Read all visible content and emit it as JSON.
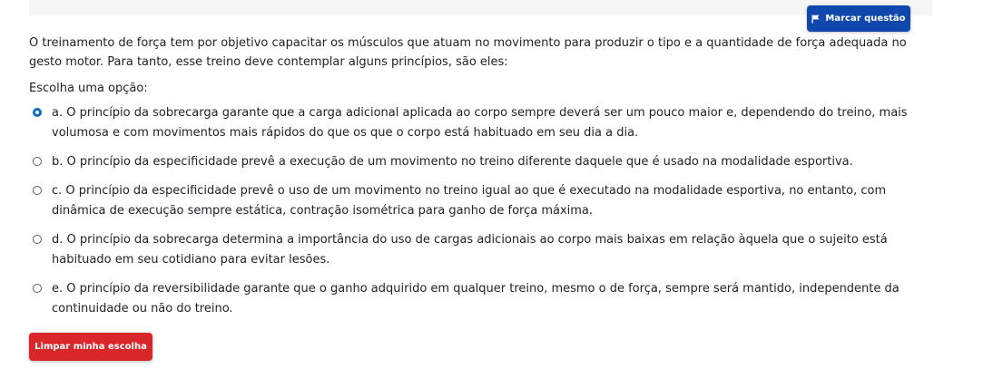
{
  "flag_button": {
    "label": "Marcar questão",
    "icon": "flag-icon"
  },
  "question": {
    "text": "O treinamento de força tem por objetivo capacitar os músculos que atuam no movimento para produzir o tipo e a quantidade de força adequada no gesto motor. Para tanto, esse treino deve contemplar alguns princípios, são eles:"
  },
  "prompt": "Escolha uma opção:",
  "options": [
    {
      "label": "a. O princípio da sobrecarga garante que a carga adicional aplicada ao corpo sempre deverá ser um pouco maior e, dependendo do treino, mais volumosa e com movimentos mais rápidos do que os que o corpo está habituado em seu dia a dia.",
      "selected": true
    },
    {
      "label": "b. O princípio da especificidade prevê a execução de um movimento no treino diferente daquele que é usado na modalidade esportiva.",
      "selected": false
    },
    {
      "label": "c. O princípio da especificidade prevê o uso de um movimento no treino igual ao que é executado na modalidade esportiva, no entanto, com dinâmica de execução sempre estática, contração isométrica para ganho de força máxima.",
      "selected": false
    },
    {
      "label": "d. O princípio da sobrecarga determina a importância do uso de cargas adicionais ao corpo mais baixas em relação àquela que o sujeito está habituado em seu cotidiano para evitar lesões.",
      "selected": false
    },
    {
      "label": "e. O princípio da reversibilidade garante que o ganho adquirido em qualquer treino, mesmo o de força, sempre será mantido, independente da continuidade ou não do treino.",
      "selected": false
    }
  ],
  "clear_button": {
    "label": "Limpar minha escolha"
  },
  "colors": {
    "flag_button_bg": "#0f47ad",
    "radio_selected": "#0f6cbf",
    "clear_button_bg": "#d9262b",
    "top_strip_bg": "#f5f5f5"
  }
}
